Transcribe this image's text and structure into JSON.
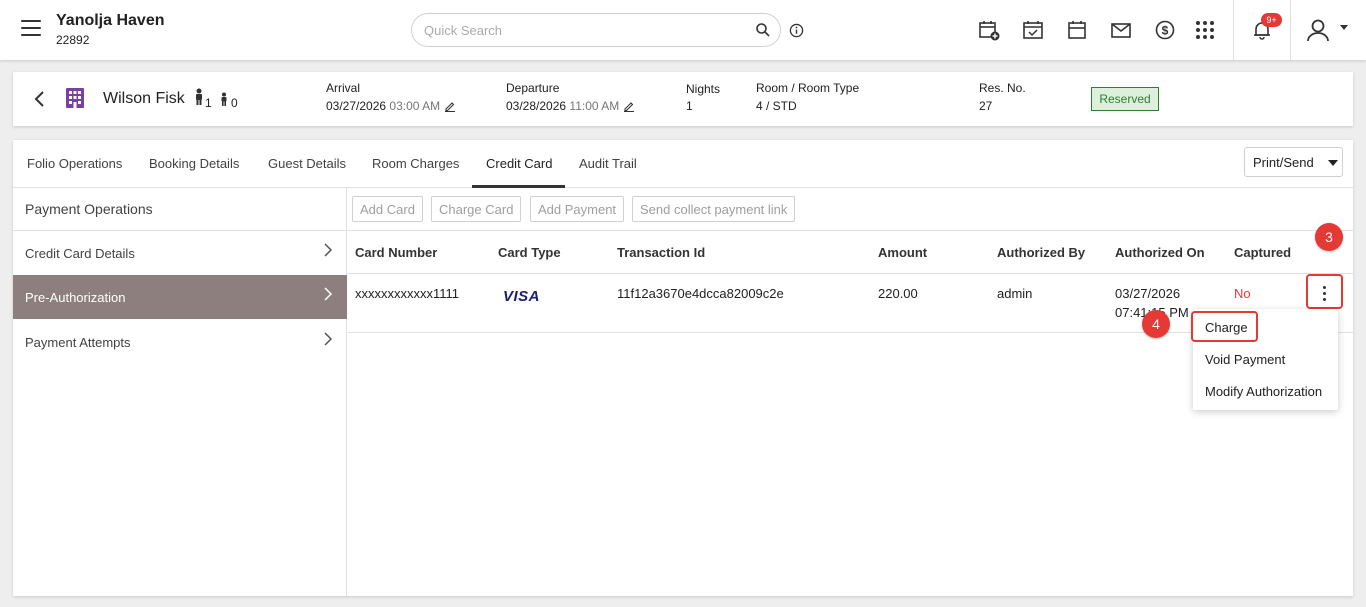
{
  "topbar": {
    "property_name": "Yanolja Haven",
    "property_id": "22892",
    "search_placeholder": "Quick Search",
    "notification_badge": "9+",
    "icons": [
      "menu-icon",
      "search-icon",
      "info-icon",
      "calendar-add-icon",
      "calendar-check-icon",
      "calendar-icon",
      "mail-icon",
      "dollar-icon",
      "apps-grid-icon",
      "bell-icon",
      "user-icon"
    ]
  },
  "guest": {
    "name": "Wilson Fisk",
    "adults": "1",
    "children": "0",
    "arrival_label": "Arrival",
    "arrival_date": "03/27/2026",
    "arrival_time": "03:00 AM",
    "departure_label": "Departure",
    "departure_date": "03/28/2026",
    "departure_time": "11:00 AM",
    "nights_label": "Nights",
    "nights_value": "1",
    "room_label": "Room / Room Type",
    "room_value": "4 / STD",
    "resno_label": "Res. No.",
    "resno_value": "27",
    "status": "Reserved"
  },
  "tabs": [
    "Folio Operations",
    "Booking Details",
    "Guest Details",
    "Room Charges",
    "Credit Card",
    "Audit Trail"
  ],
  "active_tab": "Credit Card",
  "print_send": "Print/Send",
  "left_panel": {
    "header": "Payment Operations",
    "items": [
      "Credit Card Details",
      "Pre-Authorization",
      "Payment Attempts"
    ],
    "selected": "Pre-Authorization"
  },
  "actions": [
    "Add Card",
    "Charge Card",
    "Add Payment",
    "Send collect payment link"
  ],
  "table": {
    "headers": [
      "Card Number",
      "Card Type",
      "Transaction Id",
      "Amount",
      "Authorized By",
      "Authorized On",
      "Captured"
    ],
    "rows": [
      {
        "card_number": "xxxxxxxxxxxx1111",
        "card_type": "VISA",
        "transaction_id": "11f12a3670e4dcca82009c2e",
        "amount": "220.00",
        "authorized_by": "admin",
        "authorized_on_date": "03/27/2026",
        "authorized_on_time": "07:41:15 PM",
        "captured": "No"
      }
    ]
  },
  "row_menu": [
    "Charge",
    "Void Payment",
    "Modify Authorization"
  ],
  "annotations": {
    "step_a": "3",
    "step_b": "4"
  },
  "colors": {
    "accent_red": "#e53935",
    "selected_item_bg": "#8d7f7d",
    "status_green": "#2e7d32",
    "visa_blue": "#1a1f71"
  }
}
